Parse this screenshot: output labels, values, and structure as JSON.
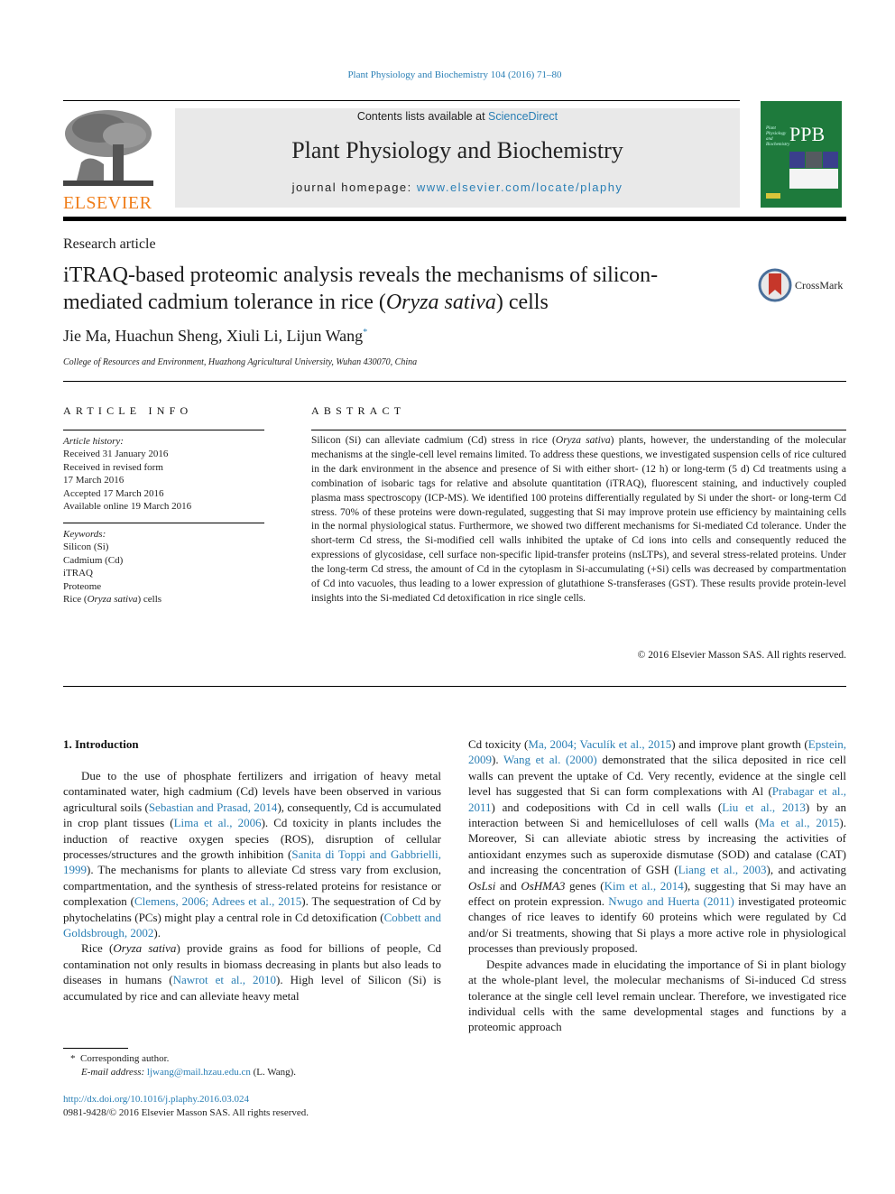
{
  "header": {
    "journal_reference": "Plant Physiology and Biochemistry 104 (2016) 71–80",
    "contents_prefix": "Contents lists available at ",
    "contents_link": "ScienceDirect",
    "journal_name": "Plant Physiology and Biochemistry",
    "homepage_prefix": "journal homepage: ",
    "homepage_link": "www.elsevier.com/locate/plaphy",
    "publisher_logo_text": "ELSEVIER",
    "cover_acronym": "PPB",
    "cover_subtitle": "Plant Physiology and Biochemistry"
  },
  "article": {
    "type": "Research article",
    "title_part1": "iTRAQ-based proteomic analysis reveals the mechanisms of silicon-mediated cadmium tolerance in rice (",
    "title_italic": "Oryza sativa",
    "title_part2": ") cells",
    "crossmark_label": "CrossMark",
    "authors": "Jie Ma, Huachun Sheng, Xiuli Li, Lijun Wang",
    "author_mark": "*",
    "affiliation": "College of Resources and Environment, Huazhong Agricultural University, Wuhan 430070, China"
  },
  "article_info": {
    "heading": "ARTICLE INFO",
    "history_label": "Article history:",
    "history": [
      "Received 31 January 2016",
      "Received in revised form",
      "17 March 2016",
      "Accepted 17 March 2016",
      "Available online 19 March 2016"
    ],
    "keywords_label": "Keywords:",
    "keywords": [
      "Silicon (Si)",
      "Cadmium (Cd)",
      "iTRAQ",
      "Proteome"
    ],
    "keyword_last_prefix": "Rice (",
    "keyword_last_italic": "Oryza sativa",
    "keyword_last_suffix": ") cells"
  },
  "abstract": {
    "heading": "ABSTRACT",
    "text_1": "Silicon (Si) can alleviate cadmium (Cd) stress in rice (",
    "text_italic": "Oryza sativa",
    "text_2": ") plants, however, the understanding of the molecular mechanisms at the single-cell level remains limited. To address these questions, we investigated suspension cells of rice cultured in the dark environment in the absence and presence of Si with either short- (12 h) or long-term (5 d) Cd treatments using a combination of isobaric tags for relative and absolute quantitation (iTRAQ), fluorescent staining, and inductively coupled plasma mass spectroscopy (ICP-MS). We identified 100 proteins differentially regulated by Si under the short- or long-term Cd stress. 70% of these proteins were down-regulated, suggesting that Si may improve protein use efficiency by maintaining cells in the normal physiological status. Furthermore, we showed two different mechanisms for Si-mediated Cd tolerance. Under the short-term Cd stress, the Si-modified cell walls inhibited the uptake of Cd ions into cells and consequently reduced the expressions of glycosidase, cell surface non-specific lipid-transfer proteins (nsLTPs), and several stress-related proteins. Under the long-term Cd stress, the amount of Cd in the cytoplasm in Si-accumulating (+Si) cells was decreased by compartmentation of Cd into vacuoles, thus leading to a lower expression of glutathione S-transferases (GST). These results provide protein-level insights into the Si-mediated Cd detoxification in rice single cells.",
    "copyright": "© 2016 Elsevier Masson SAS. All rights reserved."
  },
  "introduction": {
    "heading": "1.  Introduction",
    "left": {
      "p1_a": "Due to the use of phosphate fertilizers and irrigation of heavy metal contaminated water, high cadmium (Cd) levels have been observed in various agricultural soils (",
      "p1_ref1": "Sebastian and Prasad, 2014",
      "p1_b": "), consequently, Cd is accumulated in crop plant tissues (",
      "p1_ref2": "Lima et al., 2006",
      "p1_c": "). Cd toxicity in plants includes the induction of reactive oxygen species (ROS), disruption of cellular processes/structures and the growth inhibition (",
      "p1_ref3": "Sanita di Toppi and Gabbrielli, 1999",
      "p1_d": "). The mechanisms for plants to alleviate Cd stress vary from exclusion, compartmentation, and the synthesis of stress-related proteins for resistance or complexation (",
      "p1_ref4": "Clemens, 2006; Adrees et al., 2015",
      "p1_e": "). The sequestration of Cd by phytochelatins (PCs) might play a central role in Cd detoxification (",
      "p1_ref5": "Cobbett and Goldsbrough, 2002",
      "p1_f": ").",
      "p2_a": "Rice (",
      "p2_italic": "Oryza sativa",
      "p2_b": ") provide grains as food for billions of people, Cd contamination not only results in biomass decreasing in plants but also leads to diseases in humans (",
      "p2_ref1": "Nawrot et al., 2010",
      "p2_c": "). High level of Silicon (Si) is accumulated by rice and can alleviate heavy metal"
    },
    "right": {
      "p1_a": "Cd toxicity (",
      "p1_ref1": "Ma, 2004; Vaculík et al., 2015",
      "p1_b": ") and improve plant growth (",
      "p1_ref2": "Epstein, 2009",
      "p1_c": "). ",
      "p1_ref3": "Wang et al. (2000)",
      "p1_d": " demonstrated that the silica deposited in rice cell walls can prevent the uptake of Cd. Very recently, evidence at the single cell level has suggested that Si can form complexations with Al (",
      "p1_ref4": "Prabagar et al., 2011",
      "p1_e": ") and codepositions with Cd in cell walls (",
      "p1_ref5": "Liu et al., 2013",
      "p1_f": ") by an interaction between Si and hemicelluloses of cell walls (",
      "p1_ref6": "Ma et al., 2015",
      "p1_g": "). Moreover, Si can alleviate abiotic stress by increasing the activities of antioxidant enzymes such as superoxide dismutase (SOD) and catalase (CAT) and increasing the concentration of GSH (",
      "p1_ref7": "Liang et al., 2003",
      "p1_h": "), and activating ",
      "p1_gene1": "OsLsi",
      "p1_i": " and ",
      "p1_gene2": "OsHMA3",
      "p1_j": " genes (",
      "p1_ref8": "Kim et al., 2014",
      "p1_k": "), suggesting that Si may have an effect on protein expression. ",
      "p1_ref9": "Nwugo and Huerta (2011)",
      "p1_l": " investigated proteomic changes of rice leaves to identify 60 proteins which were regulated by Cd and/or Si treatments, showing that Si plays a more active role in physiological processes than previously proposed.",
      "p2": "Despite advances made in elucidating the importance of Si in plant biology at the whole-plant level, the molecular mechanisms of Si-induced Cd stress tolerance at the single cell level remain unclear. Therefore, we investigated rice individual cells with the same developmental stages and functions by a proteomic approach"
    }
  },
  "footnote": {
    "mark": "*",
    "corresponding": "Corresponding author.",
    "email_label": "E-mail address: ",
    "email": "ljwang@mail.hzau.edu.cn",
    "email_suffix": " (L. Wang)."
  },
  "footer": {
    "doi": "http://dx.doi.org/10.1016/j.plaphy.2016.03.024",
    "issn_copyright": "0981-9428/© 2016 Elsevier Masson SAS. All rights reserved."
  }
}
